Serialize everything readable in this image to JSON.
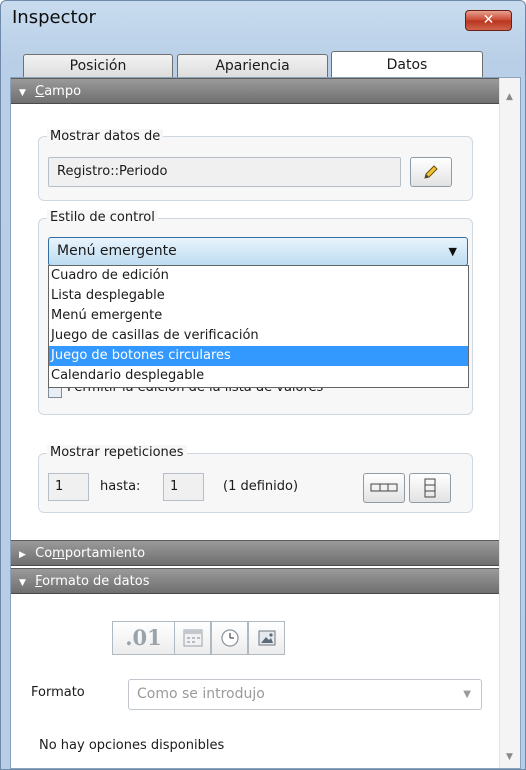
{
  "window": {
    "title": "Inspector",
    "close_label": "✕"
  },
  "tabs": [
    {
      "label": "Posición",
      "active": false
    },
    {
      "label": "Apariencia",
      "active": false
    },
    {
      "label": "Datos",
      "active": true
    }
  ],
  "sections": {
    "campo": {
      "prefix": "",
      "underline": "C",
      "rest": "ampo"
    },
    "comportamiento": {
      "prefix": "Co",
      "underline": "m",
      "rest": "portamiento"
    },
    "formato": {
      "prefix": "",
      "underline": "F",
      "rest": "ormato de datos"
    }
  },
  "mostrar_datos": {
    "label": "Mostrar datos de",
    "value": "Registro::Periodo"
  },
  "estilo_control": {
    "label": "Estilo de control",
    "selected": "Menú emergente",
    "options": [
      "Cuadro de edición",
      "Lista desplegable",
      "Menú emergente",
      "Juego de casillas de verificación",
      "Juego de botones circulares",
      "Calendario desplegable"
    ],
    "highlighted_index": 4,
    "partial_text": "Permitir la edición de la lista de valores"
  },
  "repeticiones": {
    "label": "Mostrar repeticiones",
    "from": "1",
    "to_label": "hasta:",
    "to": "1",
    "defined": "(1 definido)"
  },
  "formato_datos": {
    "format_label": "Formato",
    "format_value": "Como se introdujo",
    "buttons": [
      ".01",
      "calendar-icon",
      "clock-icon",
      "image-icon"
    ],
    "no_options": "No hay opciones disponibles"
  },
  "colors": {
    "highlight": "#3399ff",
    "section_header": "#7a7a7a",
    "window_frame": "#b9cfe6"
  }
}
